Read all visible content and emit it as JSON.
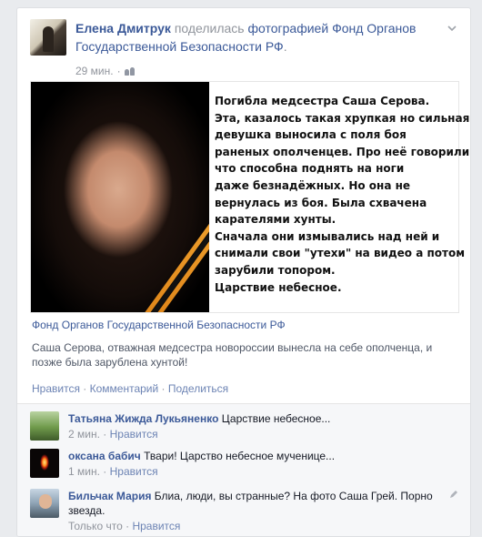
{
  "post": {
    "author": "Елена Дмитрук",
    "action": "поделилась",
    "object_link": "фотографией",
    "page_name": "Фонд Органов Государственной Безопасности РФ",
    "time": "29 мин.",
    "photo_text_lines": [
      "Погибла медсестра Саша Серова.",
      "Эта, казалось такая хрупкая но сильная",
      "девушка выносила с поля боя",
      "раненых ополченцев. Про неё говорили",
      "что способна поднять на ноги",
      "даже безнадёжных. Но она не",
      "вернулась из боя. Была схвачена",
      "карателями хунты.",
      "Сначала они измывались над ней и",
      "снимали свои \"утехи\" на видео а потом",
      "зарубили топором.",
      "Царствие небесное."
    ],
    "preview_title": "Фонд Органов Государственной Безопасности РФ",
    "preview_desc": "Саша Серова, отважная медсестра новороссии вынесла на себе ополченца, и позже была зарублена хунтой!",
    "actions": {
      "like": "Нравится",
      "comment": "Комментарий",
      "share": "Поделиться",
      "sep": " · "
    }
  },
  "comments": [
    {
      "name": "Татьяна Жижда Лукьяненко",
      "text": "Царствие небесное...",
      "time": "2 мин.",
      "like": "Нравится"
    },
    {
      "name": "оксана бабич",
      "text": "Твари! Царство небесное мученице...",
      "time": "1 мин.",
      "like": "Нравится"
    },
    {
      "name": "Бильчак Мария",
      "text": "Блиа, люди, вы странные? На фото Саша Грей. Порно звезда.",
      "time": "Только что",
      "like": "Нравится"
    }
  ],
  "colors": {
    "link": "#3b5998",
    "muted": "#90949c",
    "background": "#e9ebee"
  },
  "icons": [
    "friends-audience-icon",
    "chevron-down-icon",
    "pencil-icon"
  ]
}
